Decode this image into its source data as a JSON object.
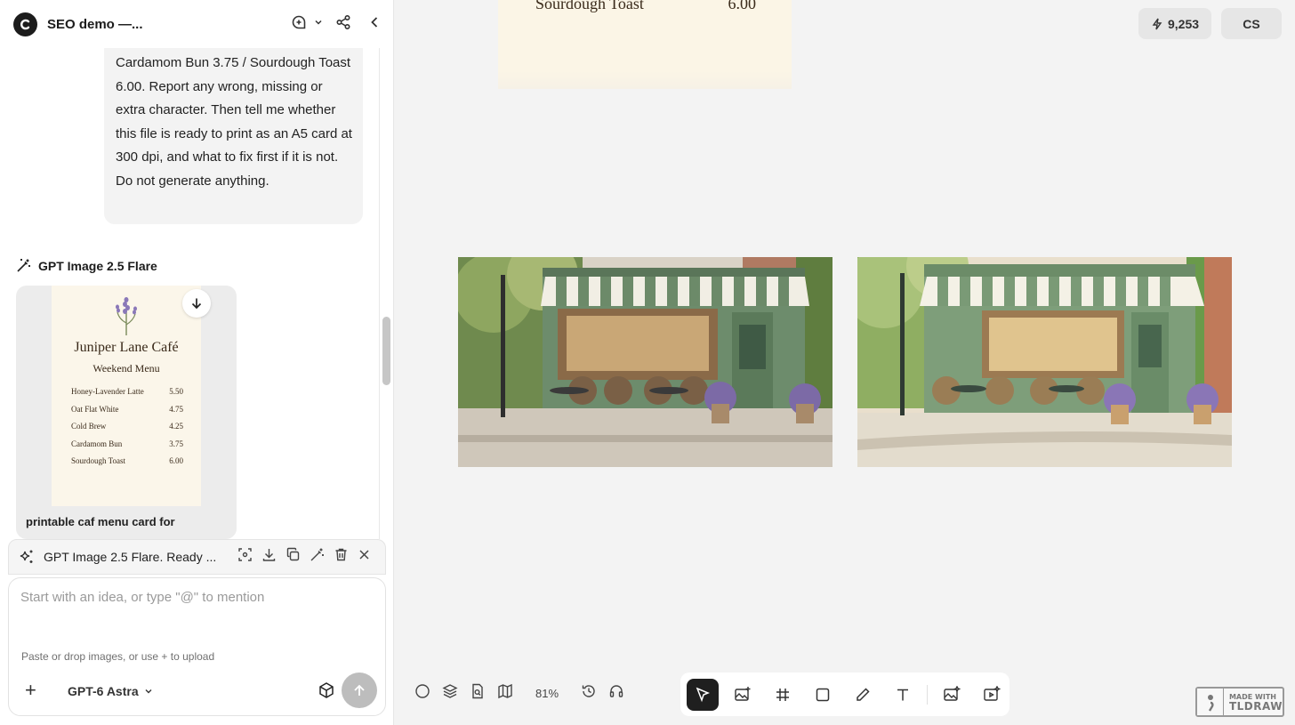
{
  "header": {
    "title": "SEO demo —..."
  },
  "chat": {
    "user_message": "Cardamom Bun 3.75 / Sourdough Toast 6.00. Report any wrong, missing or extra character. Then tell me whether this file is ready to print as an A5 card at 300 dpi, and what to fix first if it is not. Do not generate anything.",
    "model_name": "GPT Image 2.5 Flare",
    "result_menu": {
      "title": "Juniper Lane Café",
      "subtitle": "Weekend Menu",
      "items": [
        {
          "name": "Honey-Lavender Latte",
          "price": "5.50"
        },
        {
          "name": "Oat Flat White",
          "price": "4.75"
        },
        {
          "name": "Cold Brew",
          "price": "4.25"
        },
        {
          "name": "Cardamom Bun",
          "price": "3.75"
        },
        {
          "name": "Sourdough Toast",
          "price": "6.00"
        }
      ]
    },
    "result_caption": "printable caf menu card for"
  },
  "status": {
    "text": "GPT Image 2.5 Flare. Ready ..."
  },
  "composer": {
    "placeholder": "Start with an idea, or type \"@\" to mention",
    "hint": "Paste or drop images, or use + to upload",
    "model": "GPT-6 Astra"
  },
  "canvas": {
    "menu_line": {
      "name": "Sourdough Toast",
      "price": "6.00"
    },
    "credits": "9,253",
    "avatar": "CS",
    "zoom": "81%",
    "watermark_top": "MADE WITH",
    "watermark_brand": "TLDRAW"
  },
  "colors": {
    "accent_dark": "#1f1f1f",
    "canvas_bg": "#f3f3f3",
    "menu_paper": "#fbf6ea",
    "storefront_green": "#6f8a6a"
  }
}
